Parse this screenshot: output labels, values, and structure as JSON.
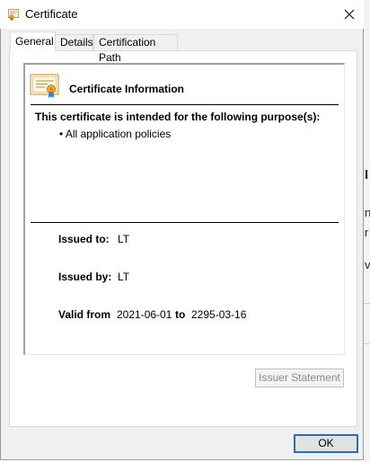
{
  "window": {
    "title": "Certificate"
  },
  "tabs": [
    {
      "label": "General",
      "active": true
    },
    {
      "label": "Details",
      "active": false
    },
    {
      "label": "Certification Path",
      "active": false
    }
  ],
  "general": {
    "heading": "Certificate Information",
    "purpose_heading": "This certificate is intended for the following purpose(s):",
    "purposes": [
      "All application policies"
    ],
    "issued_to_label": "Issued to:",
    "issued_to_value": "LT",
    "issued_by_label": "Issued by:",
    "issued_by_value": "LT",
    "valid_from_label": "Valid from",
    "valid_from_value": "2021-06-01",
    "valid_to_label": "to",
    "valid_to_value": "2295-03-16",
    "issuer_statement_label": "Issuer Statement"
  },
  "footer": {
    "ok_label": "OK"
  },
  "background_fragments": [
    "I",
    "n",
    "r",
    "v"
  ],
  "colors": {
    "accent_border": "#2e6db4",
    "disabled_text": "#8a8a8a"
  }
}
